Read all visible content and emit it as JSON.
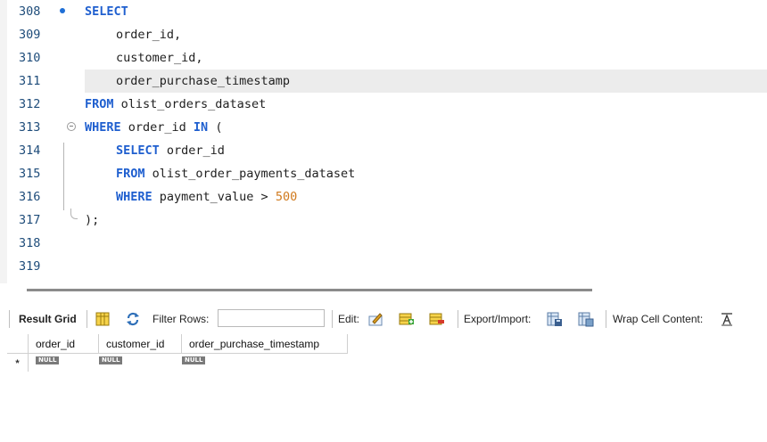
{
  "editor": {
    "lines": [
      {
        "num": "308",
        "tokens": [
          {
            "t": "SELECT",
            "c": "kw"
          }
        ],
        "indent": 0
      },
      {
        "num": "309",
        "tokens": [
          {
            "t": "order_id,",
            "c": ""
          }
        ],
        "indent": 1
      },
      {
        "num": "310",
        "tokens": [
          {
            "t": "customer_id,",
            "c": ""
          }
        ],
        "indent": 1
      },
      {
        "num": "311",
        "tokens": [
          {
            "t": "order_purchase_timestamp",
            "c": ""
          }
        ],
        "indent": 1,
        "highlight": true
      },
      {
        "num": "312",
        "tokens": [
          {
            "t": "FROM",
            "c": "kw"
          },
          {
            "t": " olist_orders_dataset",
            "c": ""
          }
        ],
        "indent": 0
      },
      {
        "num": "313",
        "tokens": [
          {
            "t": "WHERE",
            "c": "kw"
          },
          {
            "t": " order_id ",
            "c": ""
          },
          {
            "t": "IN",
            "c": "kw"
          },
          {
            "t": " (",
            "c": ""
          }
        ],
        "indent": 0
      },
      {
        "num": "314",
        "tokens": [
          {
            "t": "SELECT",
            "c": "kw"
          },
          {
            "t": " order_id",
            "c": ""
          }
        ],
        "indent": 1
      },
      {
        "num": "315",
        "tokens": [
          {
            "t": "FROM",
            "c": "kw"
          },
          {
            "t": " olist_order_payments_dataset",
            "c": ""
          }
        ],
        "indent": 1
      },
      {
        "num": "316",
        "tokens": [
          {
            "t": "WHERE",
            "c": "kw"
          },
          {
            "t": " payment_value > ",
            "c": ""
          },
          {
            "t": "500",
            "c": "num"
          }
        ],
        "indent": 1
      },
      {
        "num": "317",
        "tokens": [
          {
            "t": ");",
            "c": ""
          }
        ],
        "indent": 0
      },
      {
        "num": "318",
        "tokens": [],
        "indent": 0
      },
      {
        "num": "319",
        "tokens": [],
        "indent": 0
      }
    ]
  },
  "toolbar": {
    "result_grid": "Result Grid",
    "filter_rows": "Filter Rows:",
    "filter_value": "",
    "edit": "Edit:",
    "export_import": "Export/Import:",
    "wrap_cell_content": "Wrap Cell Content:"
  },
  "grid": {
    "columns": [
      "order_id",
      "customer_id",
      "order_purchase_timestamp"
    ],
    "new_row_marker": "*",
    "null_label": "NULL"
  },
  "colors": {
    "keyword": "#1f5fcf",
    "number": "#d07a1e",
    "line_number": "#1e4c7a",
    "breakpoint": "#1f6fd6"
  }
}
